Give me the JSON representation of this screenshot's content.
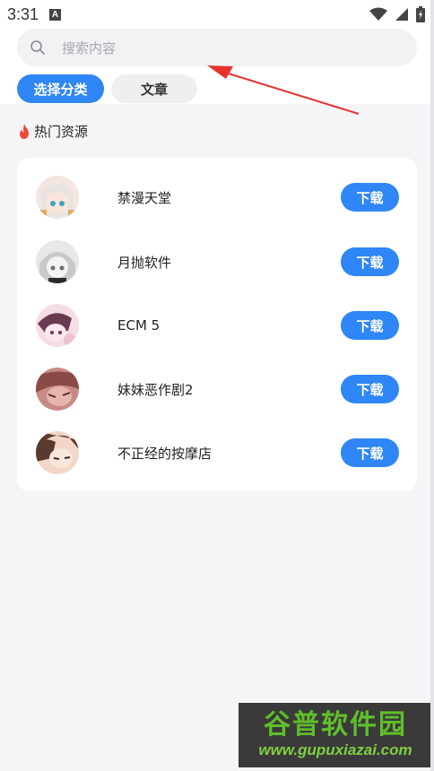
{
  "status_bar": {
    "time": "3:31",
    "notification_badge": "A"
  },
  "search": {
    "placeholder": "搜索内容"
  },
  "tabs": [
    {
      "label": "选择分类",
      "active": true
    },
    {
      "label": "文章",
      "active": false
    }
  ],
  "section": {
    "title": "热门资源"
  },
  "apps": [
    {
      "name": "禁漫天堂",
      "button": "下载",
      "avatar_colors": [
        "#f3e6e0",
        "#e7a85a"
      ]
    },
    {
      "name": "月抛软件",
      "button": "下载",
      "avatar_colors": [
        "#e8e8ea",
        "#6d6d72"
      ]
    },
    {
      "name": "ECM 5",
      "button": "下载",
      "avatar_colors": [
        "#f5dde6",
        "#6a3a52"
      ]
    },
    {
      "name": "妹妹恶作剧2",
      "button": "下载",
      "avatar_colors": [
        "#c98a86",
        "#8a4a48"
      ]
    },
    {
      "name": "不正经的按摩店",
      "button": "下载",
      "avatar_colors": [
        "#f2d6c8",
        "#5a3a30"
      ]
    }
  ],
  "watermark": {
    "cn": "谷普软件园",
    "url": "www.gupuxiazai.com"
  },
  "colors": {
    "accent": "#2f86f6",
    "background": "#f5f5f7",
    "annotation_arrow": "#e8322f"
  }
}
